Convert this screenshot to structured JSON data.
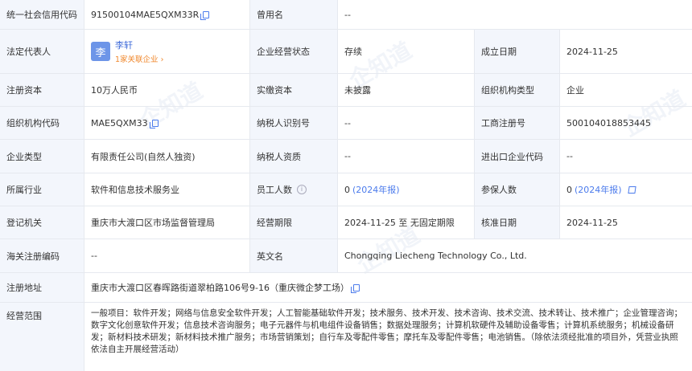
{
  "rows": {
    "r1": {
      "l1": "统一社会信用代码",
      "v1": "91500104MAE5QXM33R",
      "l2": "曾用名",
      "v2": "--"
    },
    "r2": {
      "l1": "法定代表人",
      "rep_avatar": "李",
      "rep_name": "李轩",
      "rep_sub": "1家关联企业 ›",
      "l2": "企业经营状态",
      "v2": "存续",
      "l3": "成立日期",
      "v3": "2024-11-25"
    },
    "r3": {
      "l1": "注册资本",
      "v1": "10万人民币",
      "l2": "实缴资本",
      "v2": "未披露",
      "l3": "组织机构类型",
      "v3": "企业"
    },
    "r4": {
      "l1": "组织机构代码",
      "v1": "MAE5QXM33",
      "l2": "纳税人识别号",
      "v2": "--",
      "l3": "工商注册号",
      "v3": "500104018853445"
    },
    "r5": {
      "l1": "企业类型",
      "v1": "有限责任公司(自然人独资)",
      "l2": "纳税人资质",
      "v2": "--",
      "l3": "进出口企业代码",
      "v3": "--"
    },
    "r6": {
      "l1": "所属行业",
      "v1": "软件和信息技术服务业",
      "l2": "员工人数",
      "v2": "0",
      "v2_year": "(2024年报)",
      "l3": "参保人数",
      "v3": "0",
      "v3_year": "(2024年报)"
    },
    "r7": {
      "l1": "登记机关",
      "v1": "重庆市大渡口区市场监督管理局",
      "l2": "经营期限",
      "v2": "2024-11-25 至 无固定期限",
      "l3": "核准日期",
      "v3": "2024-11-25"
    },
    "r8": {
      "l1": "海关注册编码",
      "v1": "--",
      "l2": "英文名",
      "v2": "Chongqing Liecheng Technology Co., Ltd."
    },
    "r9": {
      "l1": "注册地址",
      "v1": "重庆市大渡口区春晖路街道翠柏路106号9-16（重庆微企梦工场）"
    },
    "r10": {
      "l1": "经营范围",
      "v1": "一般项目：软件开发；网络与信息安全软件开发；人工智能基础软件开发；技术服务、技术开发、技术咨询、技术交流、技术转让、技术推广；企业管理咨询；数字文化创意软件开发；信息技术咨询服务；电子元器件与机电组件设备销售；数据处理服务；计算机软硬件及辅助设备零售；计算机系统服务；机械设备研发；新材料技术研发；新材料技术推广服务；市场营销策划；自行车及零配件零售；摩托车及零配件零售；电池销售。（除依法须经批准的项目外，凭营业执照依法自主开展经营活动）"
    }
  },
  "watermark": "企知道",
  "colors": {
    "label_bg": "#f3f6fc",
    "link": "#4b7bec",
    "accent_orange": "#f0882d"
  }
}
